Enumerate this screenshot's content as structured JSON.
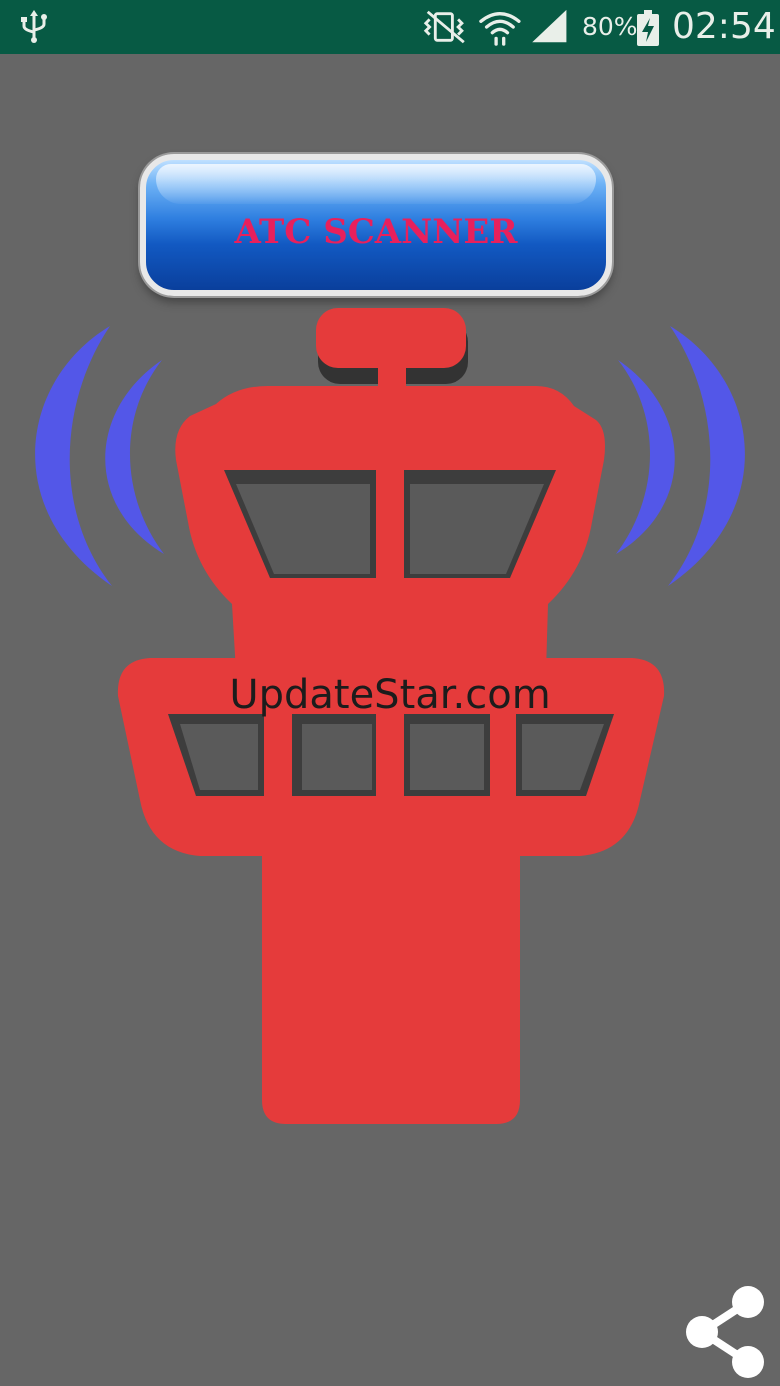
{
  "status_bar": {
    "battery_percent": "80%",
    "time": "02:54",
    "icons": [
      "usb-icon",
      "vibrate-mute-icon",
      "wifi-icon",
      "signal-icon",
      "battery-charging-icon"
    ]
  },
  "app": {
    "title_button_label": "ATC SCANNER",
    "watermark": "UpdateStar.com"
  },
  "actions": {
    "share_icon": "share-icon"
  },
  "colors": {
    "background": "#666666",
    "status_bar": "#075a44",
    "tower": "#e53b3b",
    "waves": "#5357e8",
    "title_text": "#e8205c",
    "button_blue": "#1259c2"
  }
}
